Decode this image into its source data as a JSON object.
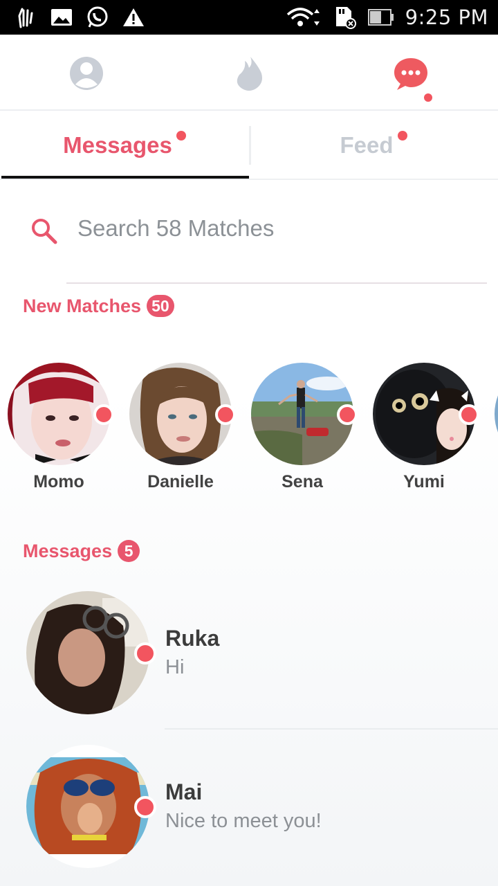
{
  "status_bar": {
    "time": "9:25 PM",
    "left_icons": [
      "hand-icon",
      "image-icon",
      "whatsapp-icon",
      "warning-icon"
    ],
    "right_icons": [
      "wifi-icon",
      "sd-card-icon",
      "battery-icon"
    ]
  },
  "top_nav": {
    "items": [
      "profile-icon",
      "flame-icon",
      "chat-icon"
    ],
    "active": "chat-icon"
  },
  "tabs": [
    {
      "label": "Messages",
      "active": true,
      "has_dot": true
    },
    {
      "label": "Feed",
      "active": false,
      "has_dot": true
    }
  ],
  "search": {
    "placeholder": "Search 58 Matches"
  },
  "new_matches": {
    "title": "New Matches",
    "count": "50",
    "items": [
      {
        "name": "Momo"
      },
      {
        "name": "Danielle"
      },
      {
        "name": "Sena"
      },
      {
        "name": "Yumi"
      }
    ]
  },
  "messages": {
    "title": "Messages",
    "count": "5",
    "items": [
      {
        "name": "Ruka",
        "text": "Hi"
      },
      {
        "name": "Mai",
        "text": "Nice to meet you!"
      }
    ]
  },
  "colors": {
    "accent": "#e8566d",
    "dot": "#f2555f",
    "inactive": "#c6cbd2"
  }
}
